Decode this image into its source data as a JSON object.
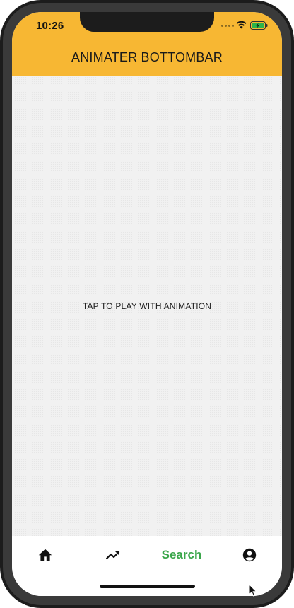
{
  "status_bar": {
    "time": "10:26",
    "icons": [
      "wifi-icon",
      "battery-icon"
    ]
  },
  "app_bar": {
    "title": "ANIMATER BOTTOMBAR",
    "background_color": "#f7b733"
  },
  "content": {
    "message": "TAP TO PLAY WITH ANIMATION"
  },
  "bottom_nav": {
    "items": [
      {
        "icon": "home-icon",
        "label": "",
        "selected": false
      },
      {
        "icon": "trending-up-icon",
        "label": "",
        "selected": false
      },
      {
        "icon": "search",
        "label": "Search",
        "selected": true
      },
      {
        "icon": "account-circle-icon",
        "label": "",
        "selected": false
      }
    ],
    "active_color": "#3aa64a"
  }
}
